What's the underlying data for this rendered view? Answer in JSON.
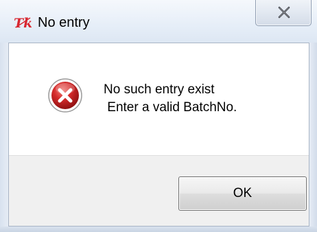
{
  "window": {
    "title": "No entry",
    "app_icon": "tk-feather-icon",
    "close_icon": "close-icon"
  },
  "dialog": {
    "icon": "error-icon",
    "message": "No such entry exist\n Enter a valid BatchNo.",
    "ok_label": "OK"
  },
  "colors": {
    "error_red": "#d42a2a",
    "tk_icon_red": "#d8262f",
    "button_border": "#707070",
    "button_area_bg": "#f0f0f0"
  }
}
